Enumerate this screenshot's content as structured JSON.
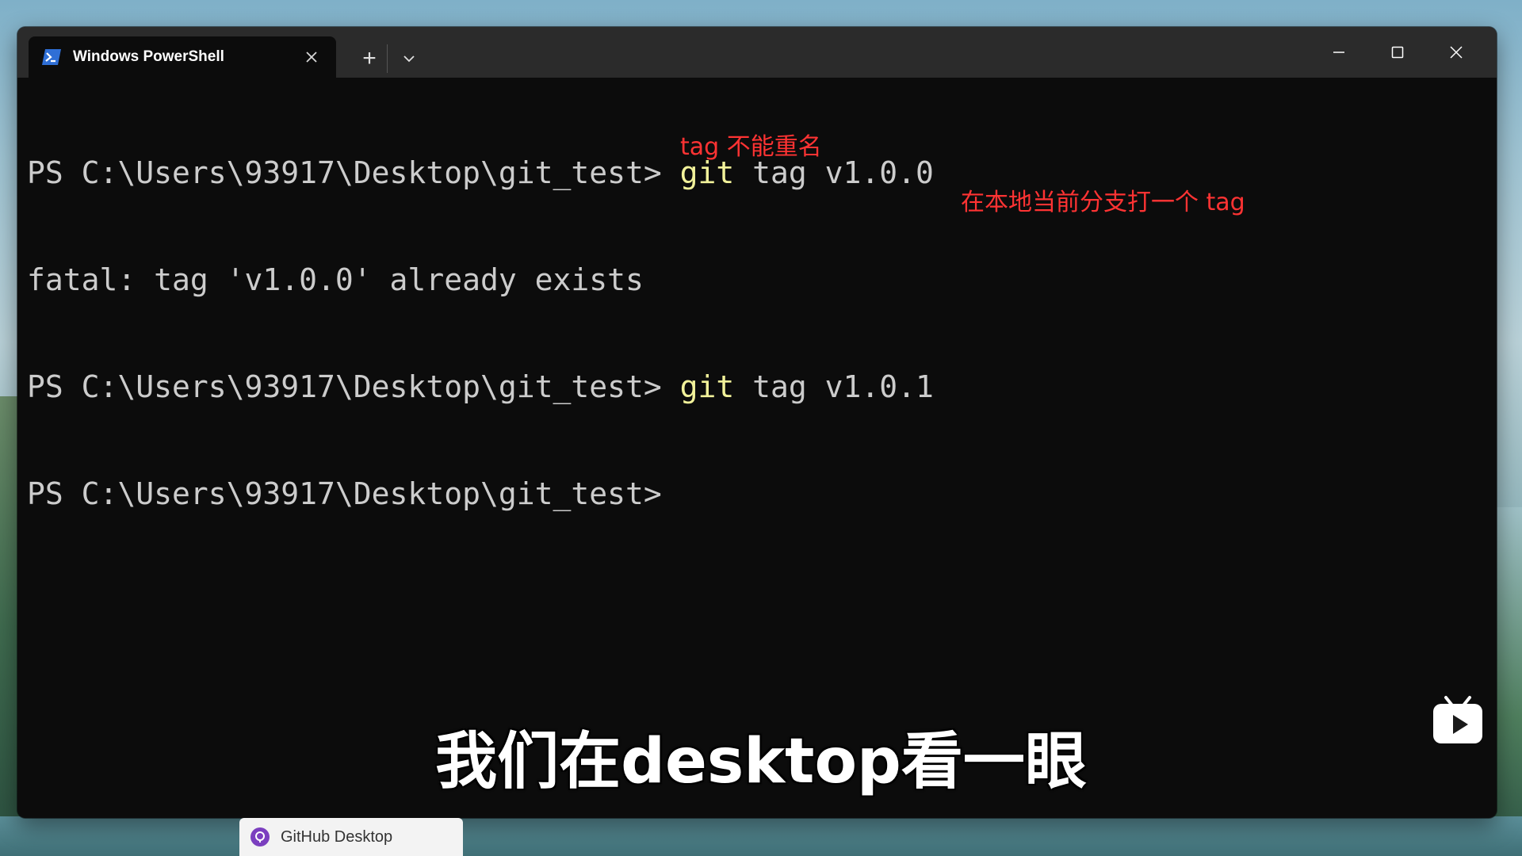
{
  "window": {
    "tab_title": "Windows PowerShell",
    "tab_icon": "powershell-icon",
    "new_tab": "+",
    "dropdown_icon": "chevron-down-icon",
    "controls": [
      "minimize-icon",
      "maximize-icon",
      "close-icon"
    ]
  },
  "terminal": {
    "lines": [
      {
        "prompt": "PS C:\\Users\\93917\\Desktop\\git_test> ",
        "command_git": "git",
        "command_rest": " tag v1.0.0"
      },
      {
        "text": "fatal: tag 'v1.0.0' already exists"
      },
      {
        "prompt": "PS C:\\Users\\93917\\Desktop\\git_test> ",
        "command_git": "git",
        "command_rest": " tag v1.0.1"
      },
      {
        "prompt": "PS C:\\Users\\93917\\Desktop\\git_test>",
        "command_git": "",
        "command_rest": ""
      }
    ]
  },
  "annotations": {
    "note1": "tag 不能重名",
    "note2": "在本地当前分支打一个 tag",
    "color": "#ff3333"
  },
  "subtitle": "我们在desktop看一眼",
  "overlay": {
    "logo_icon": "tv-play-icon"
  },
  "taskbar": {
    "preview_label": "GitHub Desktop",
    "preview_icon": "github-desktop-icon"
  },
  "colors": {
    "terminal_bg": "#0c0c0c",
    "titlebar_bg": "#2b2b2b",
    "text": "#cccccc",
    "command": "#f2f29a"
  }
}
